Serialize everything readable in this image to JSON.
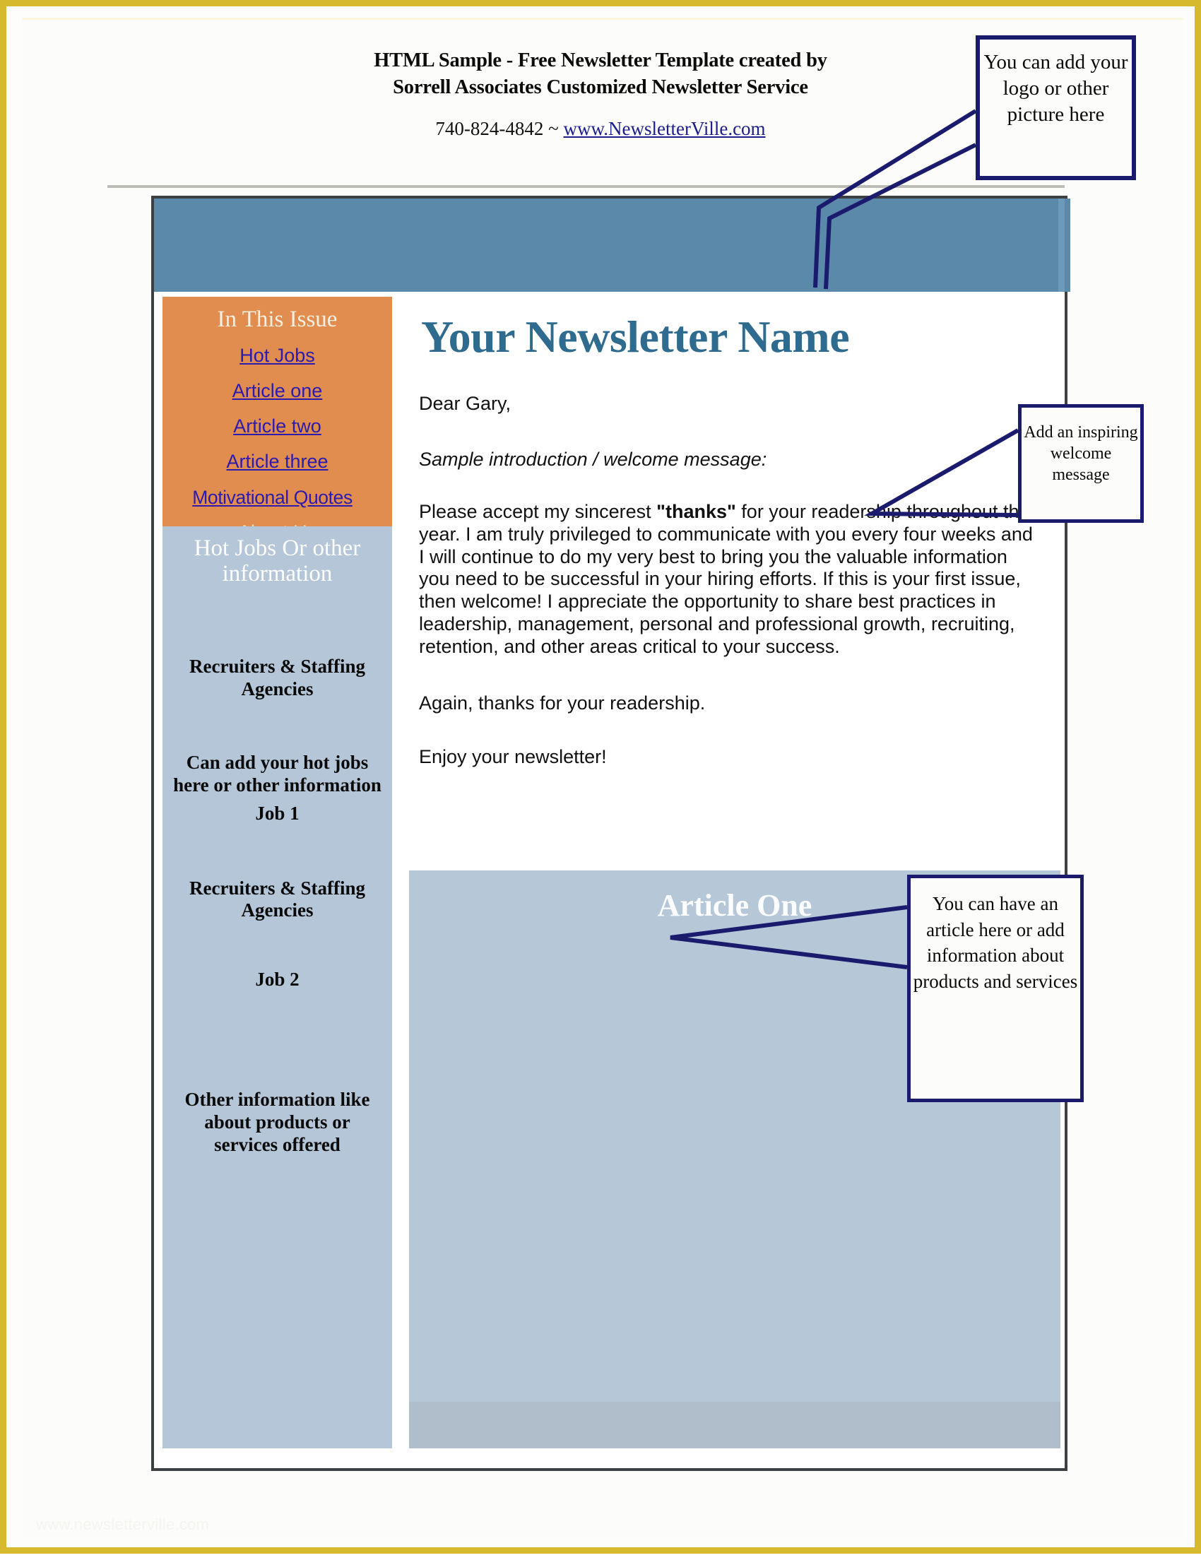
{
  "masthead": {
    "line1": "HTML Sample - Free Newsletter Template created by",
    "line2": "Sorrell Associates Customized Newsletter Service",
    "phone": "740-824-4842 ~ ",
    "url": "www.NewsletterVille.com"
  },
  "sidebar": {
    "issue_heading": "In This Issue",
    "links": [
      {
        "label": "Hot Jobs"
      },
      {
        "label": "Article one"
      },
      {
        "label": "Article two"
      },
      {
        "label": "Article three"
      },
      {
        "label": "Motivational Quotes"
      },
      {
        "label": "About Us"
      }
    ],
    "hot_jobs_heading": "Hot Jobs Or other information",
    "blocks": [
      "Recruiters & Staffing Agencies",
      "Can add your hot jobs here or other information",
      "Job 1",
      "Recruiters & Staffing Agencies",
      "Job 2",
      "Other information like about products or services offered"
    ]
  },
  "content": {
    "title": "Your Newsletter Name",
    "greeting": "Dear Gary,",
    "subject": "Sample introduction / welcome message:",
    "paragraph_pre": "Please accept my sincerest ",
    "paragraph_bold": "\"thanks\"",
    "paragraph_post": " for your readership throughout the year. I am truly privileged to communicate with you every four weeks and I will continue to do my very best to bring you the valuable information you need to be successful in your hiring efforts. If this is your first issue, then welcome! I appreciate the opportunity to share best practices in leadership, management, personal and professional growth, recruiting, retention, and other areas critical to your success.",
    "closing_1": "Again, thanks for your readership.",
    "closing_2": "Enjoy your newsletter!",
    "article_title": "Article One"
  },
  "callouts": {
    "logo": "You can add your logo or other picture here",
    "welcome": "Add an inspiring welcome message",
    "article": "You can have an article here or add information about products and services"
  },
  "footer": {
    "watermark": "www.newsletterville.com"
  },
  "colors": {
    "page_border": "#D6B92C",
    "band_blue": "#5B89AA",
    "sidebar_orange": "#E18D4F",
    "sidebar_blue": "#B4C6D7",
    "article_blue": "#B6C7D8",
    "title_blue": "#2E6B8E",
    "callout_border": "#1B1B6E",
    "link_blue": "#2B1BAE"
  }
}
